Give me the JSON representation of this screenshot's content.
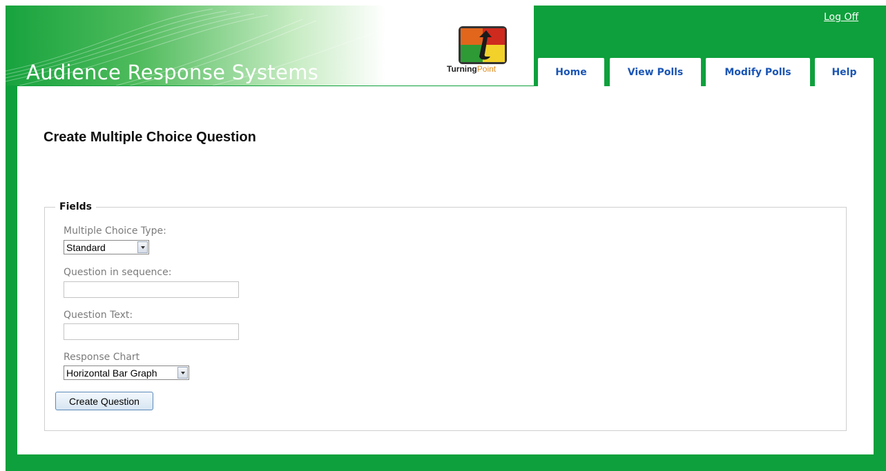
{
  "header": {
    "site_title": "Audience Response Systems",
    "logo": {
      "brand_primary": "Turning",
      "brand_secondary": "Point",
      "icon": "turningpoint-logo-icon"
    },
    "logoff_label": "Log Off"
  },
  "nav": {
    "tabs": [
      {
        "label": "Home"
      },
      {
        "label": "View Polls"
      },
      {
        "label": "Modify Polls"
      },
      {
        "label": "Help"
      }
    ]
  },
  "main": {
    "title": "Create Multiple Choice Question",
    "fieldset_legend": "Fields",
    "fields": {
      "mc_type": {
        "label": "Multiple Choice Type:",
        "value": "Standard"
      },
      "sequence": {
        "label": "Question in sequence:",
        "value": ""
      },
      "question_text": {
        "label": "Question Text:",
        "value": ""
      },
      "response_chart": {
        "label": "Response Chart",
        "value": "Horizontal Bar Graph"
      }
    },
    "submit_label": "Create Question"
  },
  "colors": {
    "frame_green": "#0ea03c",
    "link_blue": "#1a55b5",
    "label_gray": "#7b7b7b"
  }
}
